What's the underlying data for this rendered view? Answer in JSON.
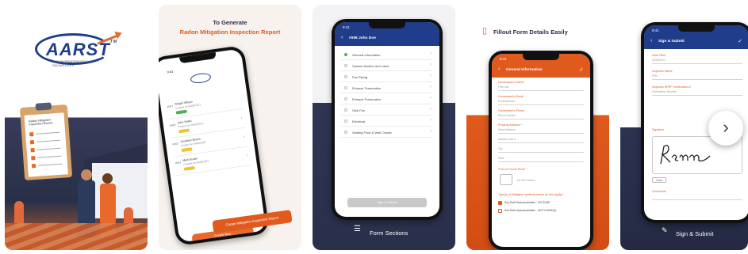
{
  "logo": {
    "brand": "AARST",
    "tm": "TM",
    "tagline": "RADON PROFESSIONALS SAVING LIVES"
  },
  "card1": {
    "clipboard_title": "Radon Mitigation Inspection Report"
  },
  "card2": {
    "headline_line1": "To Generate",
    "headline_line2": "Radon Mitigation Inspection Report",
    "phone_time": "9:41",
    "new_button": "Create New",
    "rows": [
      {
        "index": "#001",
        "name": "Abigail Wilson",
        "date": "Created on 04/06/2021"
      },
      {
        "index": "#002",
        "name": "John Smith",
        "date": "Created on 04/06/2021"
      },
      {
        "index": "#003",
        "name": "Jonathan Brown",
        "date": "Created on 04/06/2021"
      },
      {
        "index": "#004",
        "name": "Mark Brown",
        "date": "Created on 04/06/2021"
      }
    ],
    "cta": "Create Mitigation Inspection Report"
  },
  "card3": {
    "time": "9:41",
    "title": "#096 John Doe",
    "items": [
      "General Information",
      "System Monitor and Label",
      "Fan Piping",
      "Exhaust Termination",
      "Exhaust Termination",
      "Slab Fan",
      "Electrical",
      "Sealing Floor & Wall Cracks"
    ],
    "submit": "Sign & Submit",
    "footer": "Form Sections"
  },
  "card4": {
    "headline": "Fillout Form Details Easily",
    "time": "9:41",
    "title": "General Information",
    "fields": [
      {
        "label": "Homeowner's Name",
        "placeholder": "First          Last"
      },
      {
        "label": "Homeowner's Email",
        "placeholder": "Email Address"
      },
      {
        "label": "Homeowner's Phone",
        "placeholder": "Phone Number"
      },
      {
        "label": "Property Address *",
        "placeholder": "Street Address"
      },
      {
        "label": "",
        "placeholder": "Address Line 2"
      },
      {
        "label": "",
        "placeholder": "City"
      },
      {
        "label": "",
        "placeholder": "State"
      }
    ],
    "photo_label": "Front of House Photo *",
    "photo_hint": "No File Chosen",
    "checks_label": "Type(s) of Mitigation systems (select all that apply)*",
    "check1": "Sub-Slab Depressurization - NO SUMP",
    "check2": "Sub-Slab Depressurization - WITH SUMP(S)"
  },
  "card5": {
    "time": "9:41",
    "title": "Sign & Submit",
    "fields": [
      {
        "label": "Date Filled",
        "value": "04/06/2021"
      },
      {
        "label": "Inspector Name *",
        "value": "First"
      },
      {
        "label": "Inspector NRPP Certification #",
        "value": "Certification Number"
      },
      {
        "label": "Signature",
        "value": ""
      }
    ],
    "clear": "Clear",
    "comments_label": "Comments",
    "footer": "Sign & Submit"
  },
  "colors": {
    "brand_blue": "#1f3d8a",
    "accent_orange": "#e05a1e",
    "navy": "#2a2f4a"
  },
  "icons": {
    "next": "chevron-right-icon",
    "sections": "list-icon",
    "form": "document-icon",
    "sign": "pen-icon"
  }
}
